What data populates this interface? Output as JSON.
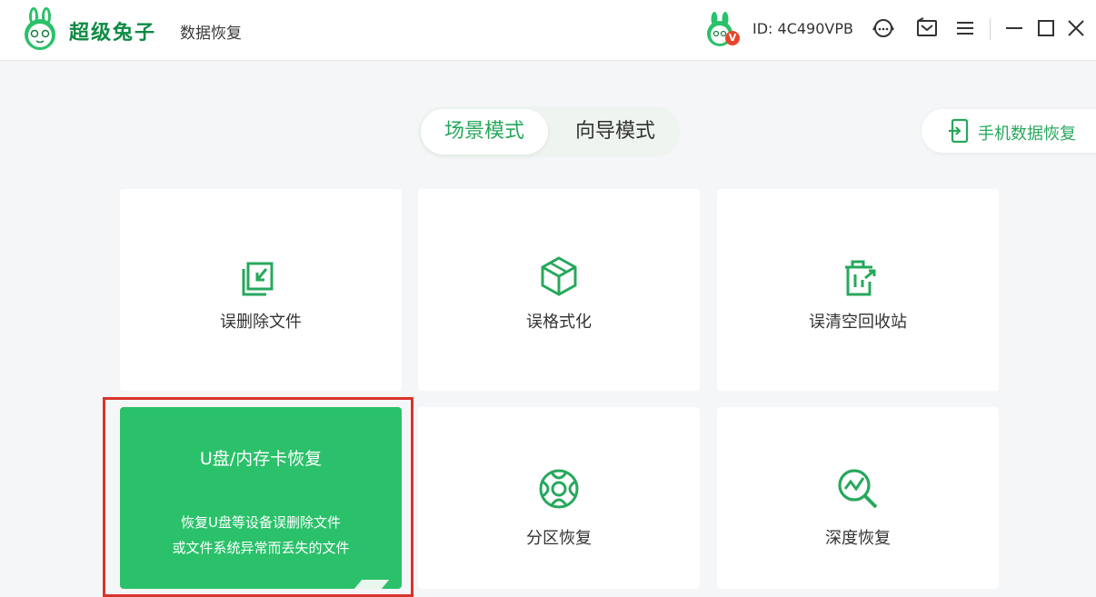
{
  "app": {
    "brand": "超级兔子",
    "product": "数据恢复",
    "user_id": "ID: 4C490VPB",
    "vip_badge": "V"
  },
  "colors": {
    "accent": "#27a85d",
    "card_highlight": "#2ac16a",
    "selection_outline": "#d9342b"
  },
  "header_icons": [
    "customer-service-icon",
    "feedback-icon",
    "menu-icon",
    "minimize-icon",
    "maximize-icon",
    "close-icon"
  ],
  "modes": {
    "active": "场景模式",
    "inactive": "向导模式"
  },
  "phone_recovery": {
    "label": "手机数据恢复"
  },
  "cards": [
    {
      "label": "误删除文件",
      "icon": "file-restore-icon"
    },
    {
      "label": "误格式化",
      "icon": "box-icon"
    },
    {
      "label": "误清空回收站",
      "icon": "recycle-bin-icon"
    },
    {
      "title": "U盘/内存卡恢复",
      "desc_line1": "恢复U盘等设备误删除文件",
      "desc_line2": "或文件系统异常而丢失的文件",
      "icon": "usb-icon"
    },
    {
      "label": "分区恢复",
      "icon": "partition-icon"
    },
    {
      "label": "深度恢复",
      "icon": "deep-scan-icon"
    }
  ]
}
